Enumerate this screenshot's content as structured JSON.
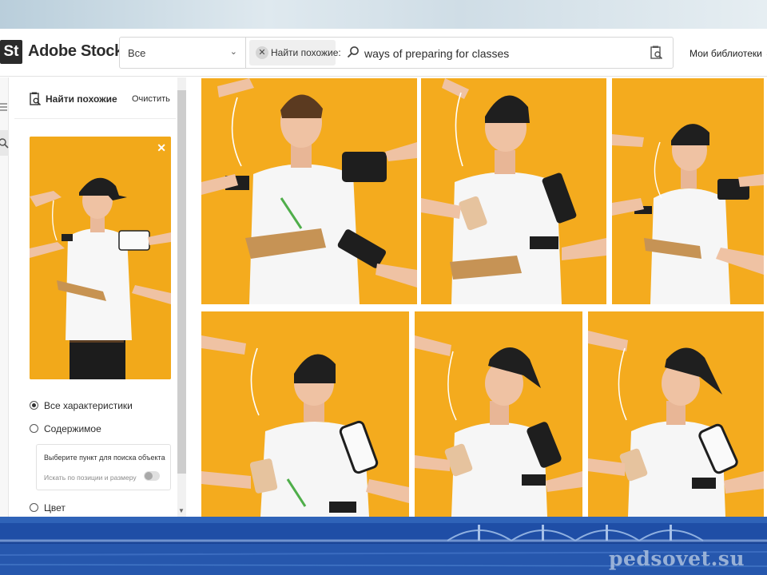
{
  "app": {
    "logo_mark": "St",
    "name": "Adobe Stock"
  },
  "search": {
    "scope": "Все",
    "chip_label": "Найти похожие:",
    "query": "ways of preparing for classes",
    "libraries": "Мои библиотеки"
  },
  "panel": {
    "title": "Найти похожие",
    "clear": "Очистить",
    "options": [
      {
        "label": "Все характеристики",
        "selected": true
      },
      {
        "label": "Содержимое",
        "selected": false
      },
      {
        "label": "Цвет",
        "selected": false
      }
    ],
    "object_box": {
      "title": "Выберите пункт для поиска объекта",
      "toggle_label": "Искать по позиции и размеру",
      "toggle_on": false
    }
  },
  "results": {
    "count_visible": 6,
    "thumb_color": "#f4ab1e"
  },
  "colors": {
    "accent_orange": "#f4ab1e",
    "banner_blue": "#1d4ea3"
  },
  "watermark": "pedsovet.su"
}
